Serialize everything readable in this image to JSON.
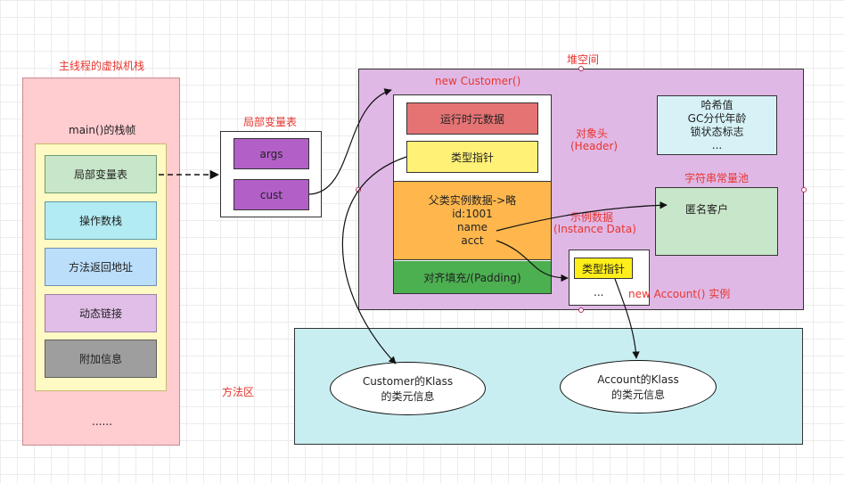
{
  "thread_vm": {
    "title": "主线程的虚拟机栈",
    "frame_title": "main()的栈帧",
    "items": [
      "局部变量表",
      "操作数栈",
      "方法返回地址",
      "动态链接",
      "附加信息"
    ],
    "ellipsis": "......"
  },
  "local_vars": {
    "title": "局部变量表",
    "items": [
      "args",
      "cust"
    ]
  },
  "heap": {
    "title": "堆空间",
    "new_customer": "new Customer()",
    "runtime_meta": "运行时元数据",
    "type_pointer": "类型指针",
    "header_label_1": "对象头",
    "header_label_2": "(Header)",
    "instance_lines": [
      "父类实例数据->略",
      "id:1001",
      "name",
      "acct"
    ],
    "instance_label_1": "示例数据",
    "instance_label_2": "(Instance Data)",
    "padding": "对齐填充/(Padding)",
    "hash_lines": [
      "哈希值",
      "GC分代年龄",
      "锁状态标志",
      "..."
    ],
    "string_pool_title": "字符串常量池",
    "string_pool_value": "匿名客户",
    "account_type_pointer": "类型指针",
    "account_ellipsis": "...",
    "account_label": "new Account() 实例"
  },
  "method_area": {
    "title": "方法区",
    "customer_klass_1": "Customer的Klass",
    "customer_klass_2": "的类元信息",
    "account_klass_1": "Account的Klass",
    "account_klass_2": "的类元信息"
  },
  "colors": {
    "stack_bg": "#ffccd0",
    "frame_bg": "#fff9c4",
    "local_vars": "#c8e6c9",
    "operand_stack": "#b2ebf2",
    "return_addr": "#bbdefb",
    "dynamic_link": "#e1bee7",
    "extra_info": "#9e9e9e",
    "purple": "#b35fc8",
    "heap_bg": "#e0b8e6",
    "runtime_meta": "#e57373",
    "type_pointer": "#fff176",
    "instance": "#ffb74d",
    "padding": "#4caf50",
    "method_area": "#c9eef2",
    "label_red": "#e8352e"
  }
}
